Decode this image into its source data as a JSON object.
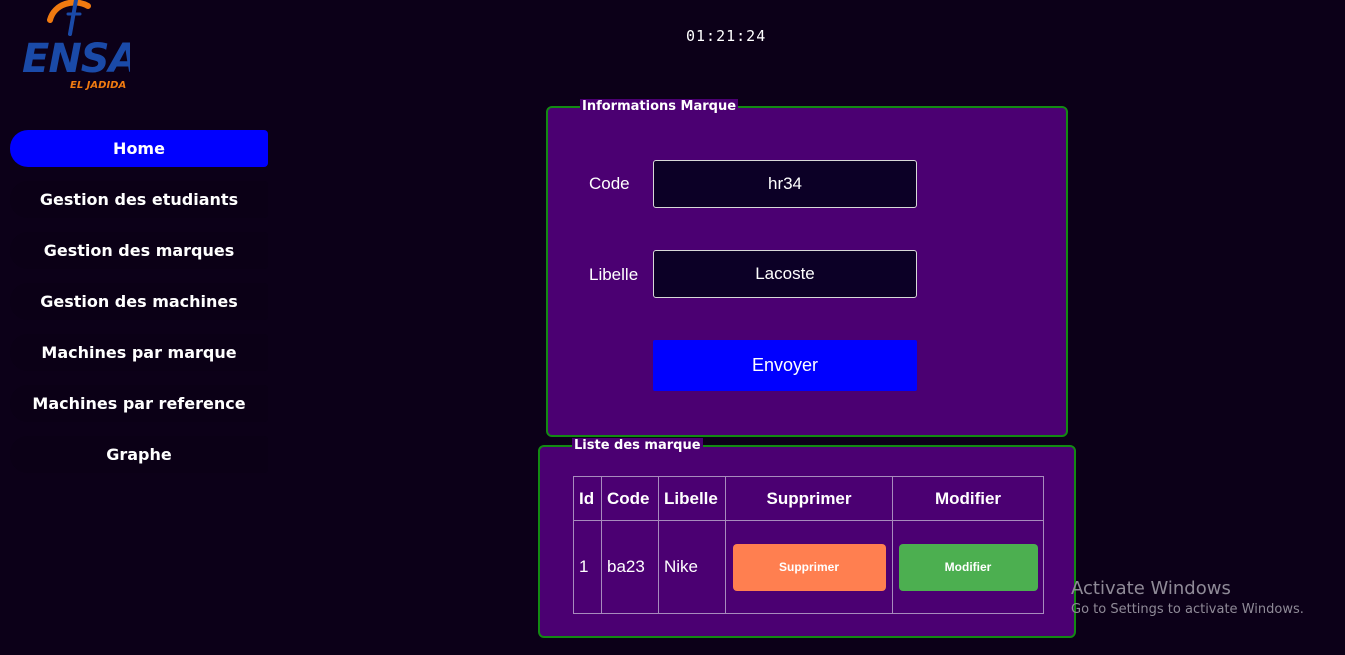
{
  "logo": {
    "text": "ENSA",
    "subtext": "EL JADIDA"
  },
  "clock": "01:21:24",
  "sidebar": {
    "items": [
      {
        "label": "Home",
        "active": true
      },
      {
        "label": "Gestion des etudiants"
      },
      {
        "label": "Gestion des marques"
      },
      {
        "label": "Gestion des machines"
      },
      {
        "label": "Machines par marque"
      },
      {
        "label": "Machines par reference"
      },
      {
        "label": "Graphe"
      }
    ]
  },
  "form": {
    "legend": "Informations Marque",
    "code_label": "Code",
    "code_value": "hr34",
    "libelle_label": "Libelle",
    "libelle_value": "Lacoste",
    "submit_label": "Envoyer"
  },
  "list": {
    "legend": "Liste des marque",
    "columns": [
      "Id",
      "Code",
      "Libelle",
      "Supprimer",
      "Modifier"
    ],
    "rows": [
      {
        "id": "1",
        "code": "ba23",
        "libelle": "Nike",
        "delete_label": "Supprimer",
        "edit_label": "Modifier"
      }
    ]
  },
  "watermark": {
    "title": "Activate Windows",
    "subtitle": "Go to Settings to activate Windows."
  },
  "colors": {
    "background": "#0c0018",
    "panel": "#4b0072",
    "panel_border": "#138a13",
    "accent_blue": "#0000ff",
    "delete": "#ff7f50",
    "edit": "#4caf50"
  }
}
